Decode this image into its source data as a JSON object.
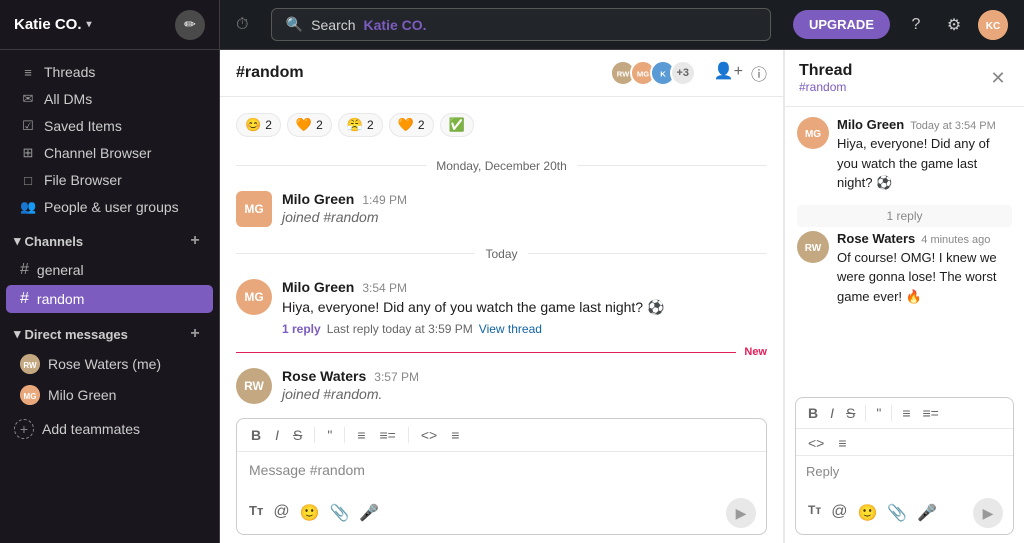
{
  "workspace": {
    "name": "Katie CO.",
    "edit_icon": "✏"
  },
  "topnav": {
    "search_placeholder": "Search",
    "search_workspace": "Katie CO.",
    "upgrade_label": "UPGRADE",
    "history_icon": "⏱"
  },
  "sidebar": {
    "nav_items": [
      {
        "id": "threads",
        "icon": "≡",
        "label": "Threads"
      },
      {
        "id": "all-dms",
        "icon": "✉",
        "label": "All DMs"
      },
      {
        "id": "saved-items",
        "icon": "☑",
        "label": "Saved Items"
      },
      {
        "id": "channel-browser",
        "icon": "⊞",
        "label": "Channel Browser"
      },
      {
        "id": "file-browser",
        "icon": "□",
        "label": "File Browser"
      },
      {
        "id": "people-groups",
        "icon": "👥",
        "label": "People & user groups"
      }
    ],
    "channels_header": "Channels",
    "channels": [
      {
        "id": "general",
        "name": "general",
        "active": false
      },
      {
        "id": "random",
        "name": "random",
        "active": true
      }
    ],
    "dm_header": "Direct messages",
    "dms": [
      {
        "id": "rose-waters",
        "name": "Rose Waters (me)",
        "initials": "RW",
        "color": "#c4a882"
      },
      {
        "id": "milo-green",
        "name": "Milo Green",
        "initials": "MG",
        "color": "#e8a87c"
      }
    ],
    "add_teammates_label": "Add teammates"
  },
  "channel": {
    "name": "#random",
    "avatars": [
      "RW",
      "MG",
      "K"
    ],
    "extra_count": "+3",
    "add_member_icon": "👤",
    "info_icon": "ⓘ"
  },
  "messages": {
    "emoji_reactions": [
      {
        "emoji": "😊",
        "count": "2"
      },
      {
        "emoji": "🧡",
        "count": "2"
      },
      {
        "emoji": "😤",
        "count": "2"
      },
      {
        "emoji": "🧡",
        "count": "2"
      },
      {
        "emoji": "✅",
        "count": ""
      }
    ],
    "date_label_monday": "Monday, December 20th",
    "date_label_today": "Today",
    "messages_list": [
      {
        "id": "msg1",
        "author": "Milo Green",
        "time": "1:49 PM",
        "text": "joined #random",
        "joined": true,
        "avatar_initials": "MG",
        "avatar_color": "#e8a87c"
      },
      {
        "id": "msg2",
        "author": "Milo Green",
        "time": "3:54 PM",
        "text": "Hiya, everyone! Did any of you watch the game last night? ⚽",
        "joined": false,
        "avatar_initials": "MG",
        "avatar_color": "#e8a87c",
        "reply_count": "1 reply",
        "reply_time": "Last reply today at 3:59 PM",
        "view_thread": "View thread"
      },
      {
        "id": "msg3",
        "author": "Rose Waters",
        "time": "3:57 PM",
        "text": "joined #random.",
        "joined": true,
        "avatar_initials": "RW",
        "avatar_color": "#c4a882",
        "new": true
      }
    ],
    "input_placeholder": "Message #random"
  },
  "thread_panel": {
    "title": "Thread",
    "subtitle": "#random",
    "messages": [
      {
        "id": "tmsg1",
        "author": "Milo Green",
        "time": "Today at 3:54 PM",
        "text": "Hiya, everyone! Did any of you watch the game last night? ⚽",
        "avatar_initials": "MG",
        "avatar_color": "#e8a87c"
      },
      {
        "id": "tmsg2",
        "author": "Rose Waters",
        "time": "4 minutes ago",
        "text": "Of course! OMG! I knew we were gonna lose! The worst game ever! 🔥",
        "avatar_initials": "RW",
        "avatar_color": "#c4a882"
      }
    ],
    "reply_count": "1 reply",
    "reply_placeholder": "Reply",
    "toolbar_icons": [
      "B",
      "I",
      "S",
      "\"",
      "≡",
      "≡="
    ]
  },
  "toolbar": {
    "bold": "B",
    "italic": "I",
    "strike": "S",
    "quote": "\"",
    "list_bullet": "≡",
    "list_number": "≡=",
    "code": "<>",
    "code_block": "≡"
  }
}
